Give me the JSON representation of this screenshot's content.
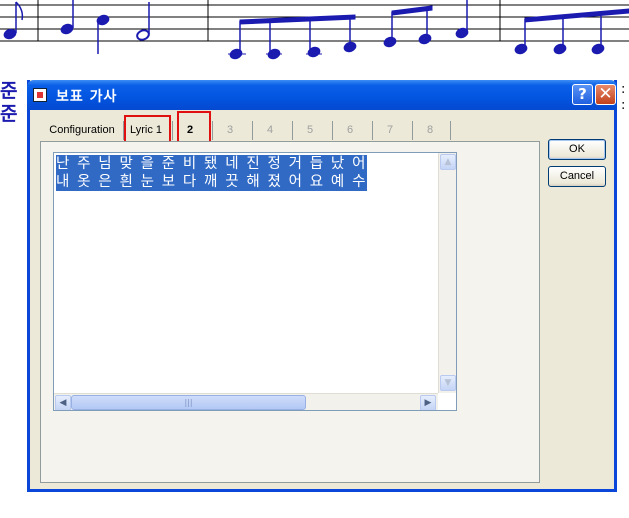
{
  "side_glyphs": [
    "준",
    "준"
  ],
  "right_marks": [
    ":",
    ":"
  ],
  "dialog": {
    "title": "보표 가사",
    "help_glyph": "?",
    "close_glyph": "✕",
    "tabs": [
      {
        "label": "Configuration",
        "enabled": true
      },
      {
        "label": "Lyric 1",
        "enabled": true
      },
      {
        "label": "2",
        "enabled": true,
        "selected": true
      },
      {
        "label": "3",
        "enabled": false
      },
      {
        "label": "4",
        "enabled": false
      },
      {
        "label": "5",
        "enabled": false
      },
      {
        "label": "6",
        "enabled": false
      },
      {
        "label": "7",
        "enabled": false
      },
      {
        "label": "8",
        "enabled": false
      }
    ],
    "editor": {
      "lines": [
        "난 주 님 맞 을 준 비 됐 네 진 정 거 듭 났 어",
        "내 옷 은 흰 눈 보 다 깨 끗 해 졌 어 요 예 수"
      ]
    },
    "ok_label": "OK",
    "cancel_label": "Cancel"
  }
}
